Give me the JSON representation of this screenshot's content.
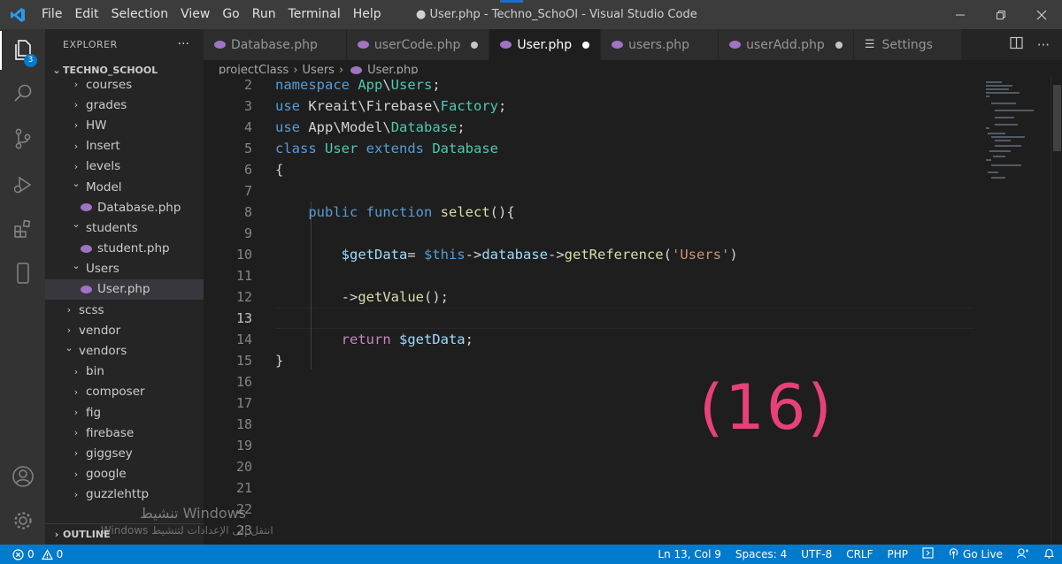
{
  "window": {
    "title": "● User.php - Techno_SchoOl - Visual Studio Code",
    "menu": [
      "File",
      "Edit",
      "Selection",
      "View",
      "Go",
      "Run",
      "Terminal",
      "Help"
    ]
  },
  "activity_bar": {
    "explorer_badge": "3"
  },
  "sidebar": {
    "title": "EXPLORER",
    "more": "···",
    "project": "TECHNO_SCHOOL",
    "items": [
      {
        "label": "courses",
        "type": "folder",
        "state": "closed",
        "depth": 1
      },
      {
        "label": "grades",
        "type": "folder",
        "state": "closed",
        "depth": 1
      },
      {
        "label": "HW",
        "type": "folder",
        "state": "closed",
        "depth": 1
      },
      {
        "label": "Insert",
        "type": "folder",
        "state": "closed",
        "depth": 1
      },
      {
        "label": "levels",
        "type": "folder",
        "state": "closed",
        "depth": 1
      },
      {
        "label": "Model",
        "type": "folder",
        "state": "open",
        "depth": 1
      },
      {
        "label": "Database.php",
        "type": "php",
        "depth": 2
      },
      {
        "label": "students",
        "type": "folder",
        "state": "open",
        "depth": 1
      },
      {
        "label": "student.php",
        "type": "php",
        "depth": 2
      },
      {
        "label": "Users",
        "type": "folder",
        "state": "open",
        "depth": 1
      },
      {
        "label": "User.php",
        "type": "php",
        "depth": 2,
        "selected": true
      },
      {
        "label": "scss",
        "type": "folder",
        "state": "closed",
        "depth": 0
      },
      {
        "label": "vendor",
        "type": "folder",
        "state": "closed",
        "depth": 0
      },
      {
        "label": "vendors",
        "type": "folder",
        "state": "open",
        "depth": 0
      },
      {
        "label": "bin",
        "type": "folder",
        "state": "closed",
        "depth": 1
      },
      {
        "label": "composer",
        "type": "folder",
        "state": "closed",
        "depth": 1
      },
      {
        "label": "fig",
        "type": "folder",
        "state": "closed",
        "depth": 1
      },
      {
        "label": "firebase",
        "type": "folder",
        "state": "closed",
        "depth": 1
      },
      {
        "label": "giggsey",
        "type": "folder",
        "state": "closed",
        "depth": 1
      },
      {
        "label": "google",
        "type": "folder",
        "state": "closed",
        "depth": 1
      },
      {
        "label": "guzzlehttp",
        "type": "folder",
        "state": "closed",
        "depth": 1
      }
    ],
    "outline": "OUTLINE"
  },
  "tabs": [
    {
      "label": "Database.php",
      "icon": "php-icon",
      "dirty": false,
      "active": false
    },
    {
      "label": "userCode.php",
      "icon": "php-icon",
      "dirty": true,
      "active": false
    },
    {
      "label": "User.php",
      "icon": "php-icon",
      "dirty": true,
      "active": true
    },
    {
      "label": "users.php",
      "icon": "php-icon",
      "dirty": false,
      "active": false
    },
    {
      "label": "userAdd.php",
      "icon": "php-icon",
      "dirty": true,
      "active": false
    },
    {
      "label": "Settings",
      "icon": "settings-icon",
      "dirty": false,
      "active": false
    }
  ],
  "breadcrumb": [
    "projectClass",
    "Users",
    "User.php"
  ],
  "editor": {
    "current_line": 13,
    "line_numbers": [
      "2",
      "3",
      "4",
      "5",
      "6",
      "7",
      "8",
      "9",
      "10",
      "11",
      "12",
      "13",
      "14",
      "15",
      "16",
      "17",
      "18",
      "19",
      "20",
      "21",
      "22",
      "23"
    ],
    "lines": [
      [
        {
          "t": "namespace ",
          "c": "kw"
        },
        {
          "t": "App",
          "c": "ns"
        },
        {
          "t": "\\",
          "c": "op"
        },
        {
          "t": "Users",
          "c": "ns"
        },
        {
          "t": ";",
          "c": "op"
        }
      ],
      [
        {
          "t": "use ",
          "c": "kw"
        },
        {
          "t": "Kreait",
          "c": "op"
        },
        {
          "t": "\\",
          "c": "op"
        },
        {
          "t": "Firebase",
          "c": "op"
        },
        {
          "t": "\\",
          "c": "op"
        },
        {
          "t": "Factory",
          "c": "ns"
        },
        {
          "t": ";",
          "c": "op"
        }
      ],
      [
        {
          "t": "use ",
          "c": "kw"
        },
        {
          "t": "App",
          "c": "op"
        },
        {
          "t": "\\",
          "c": "op"
        },
        {
          "t": "Model",
          "c": "op"
        },
        {
          "t": "\\",
          "c": "op"
        },
        {
          "t": "Database",
          "c": "ns"
        },
        {
          "t": ";",
          "c": "op"
        }
      ],
      [
        {
          "t": "class ",
          "c": "kw"
        },
        {
          "t": "User ",
          "c": "ns"
        },
        {
          "t": "extends ",
          "c": "kw"
        },
        {
          "t": "Database",
          "c": "ns"
        }
      ],
      [
        {
          "t": "{",
          "c": "op"
        }
      ],
      [],
      [
        {
          "t": "    public ",
          "c": "kw"
        },
        {
          "t": "function ",
          "c": "kw"
        },
        {
          "t": "select",
          "c": "fn"
        },
        {
          "t": "(){",
          "c": "op"
        }
      ],
      [],
      [
        {
          "t": "        $getData",
          "c": "var"
        },
        {
          "t": "= ",
          "c": "op"
        },
        {
          "t": "$this",
          "c": "kw"
        },
        {
          "t": "->",
          "c": "op"
        },
        {
          "t": "database",
          "c": "var"
        },
        {
          "t": "->",
          "c": "op"
        },
        {
          "t": "getReference",
          "c": "fn"
        },
        {
          "t": "(",
          "c": "op"
        },
        {
          "t": "'Users'",
          "c": "str"
        },
        {
          "t": ")",
          "c": "op"
        }
      ],
      [],
      [
        {
          "t": "        ->",
          "c": "op"
        },
        {
          "t": "getValue",
          "c": "fn"
        },
        {
          "t": "();",
          "c": "op"
        }
      ],
      [],
      [
        {
          "t": "        return ",
          "c": "ctl"
        },
        {
          "t": "$getData",
          "c": "var"
        },
        {
          "t": ";",
          "c": "op"
        }
      ],
      [
        {
          "t": "}",
          "c": "op"
        }
      ],
      [],
      [],
      [],
      [],
      [],
      [],
      [],
      []
    ]
  },
  "overlay_label": "(16)",
  "watermark": {
    "line1": "تنشيط Windows",
    "line2": "انتقل إلى الإعدادات لتنشيط Windows."
  },
  "status": {
    "problems": "0",
    "warnings": "0",
    "position": "Ln 13, Col 9",
    "spaces": "Spaces: 4",
    "encoding": "UTF-8",
    "eol": "CRLF",
    "language": "PHP",
    "golive": "Go Live"
  },
  "colors": {
    "statusbar": "#007acc",
    "overlay": "#e8407a",
    "php_icon": "#a074c4"
  }
}
